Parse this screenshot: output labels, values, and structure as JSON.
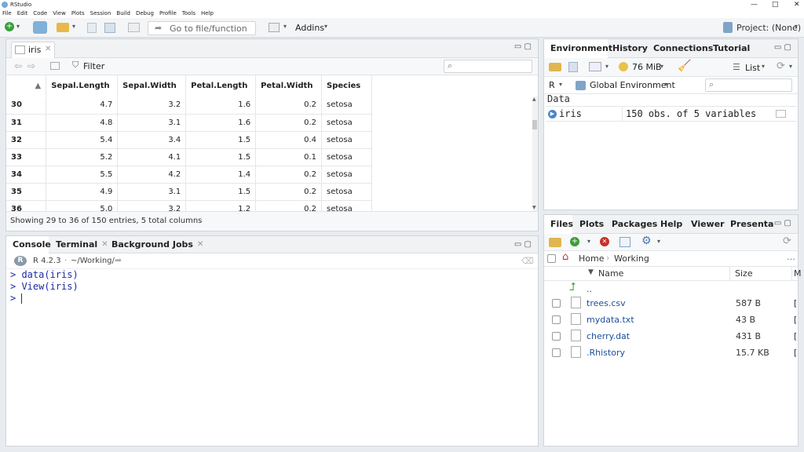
{
  "window": {
    "title": "RStudio",
    "controls": [
      "—",
      "□",
      "✕"
    ]
  },
  "menu": [
    "File",
    "Edit",
    "Code",
    "View",
    "Plots",
    "Session",
    "Build",
    "Debug",
    "Profile",
    "Tools",
    "Help"
  ],
  "toolbar": {
    "goto_placeholder": "Go to file/function",
    "addins": "Addins",
    "project": "Project: (None)"
  },
  "viewer": {
    "tab": "iris",
    "filter": "Filter",
    "columns": [
      "Sepal.Length",
      "Sepal.Width",
      "Petal.Length",
      "Petal.Width",
      "Species"
    ],
    "rows": [
      [
        "30",
        "4.7",
        "3.2",
        "1.6",
        "0.2",
        "setosa"
      ],
      [
        "31",
        "4.8",
        "3.1",
        "1.6",
        "0.2",
        "setosa"
      ],
      [
        "32",
        "5.4",
        "3.4",
        "1.5",
        "0.4",
        "setosa"
      ],
      [
        "33",
        "5.2",
        "4.1",
        "1.5",
        "0.1",
        "setosa"
      ],
      [
        "34",
        "5.5",
        "4.2",
        "1.4",
        "0.2",
        "setosa"
      ],
      [
        "35",
        "4.9",
        "3.1",
        "1.5",
        "0.2",
        "setosa"
      ],
      [
        "36",
        "5.0",
        "3.2",
        "1.2",
        "0.2",
        "setosa"
      ]
    ],
    "status": "Showing 29 to 36 of 150 entries, 5 total columns"
  },
  "console": {
    "tabs": [
      "Console",
      "Terminal",
      "Background Jobs"
    ],
    "version": "R 4.2.3",
    "path": "~/Working/",
    "lines": [
      "> data(iris)",
      "> View(iris)",
      ">"
    ]
  },
  "environment": {
    "tabs": [
      "Environment",
      "History",
      "Connections",
      "Tutorial"
    ],
    "memory": "76 MiB",
    "list": "List",
    "lang": "R",
    "scope": "Global Environment",
    "section": "Data",
    "var_name": "iris",
    "var_value": "150 obs. of 5 variables"
  },
  "files": {
    "tabs": [
      "Files",
      "Plots",
      "Packages",
      "Help",
      "Viewer",
      "Presenta"
    ],
    "breadcrumb": [
      "Home",
      "Working"
    ],
    "headers": [
      "Name",
      "Size",
      "M"
    ],
    "up": "..",
    "items": [
      {
        "name": "trees.csv",
        "size": "587 B",
        "m": "["
      },
      {
        "name": "mydata.txt",
        "size": "43 B",
        "m": "["
      },
      {
        "name": "cherry.dat",
        "size": "431 B",
        "m": "["
      },
      {
        "name": ".Rhistory",
        "size": "15.7 KB",
        "m": "["
      }
    ]
  },
  "colors": {
    "accent": "#1a4f9c",
    "bg": "#e8ecf0"
  }
}
